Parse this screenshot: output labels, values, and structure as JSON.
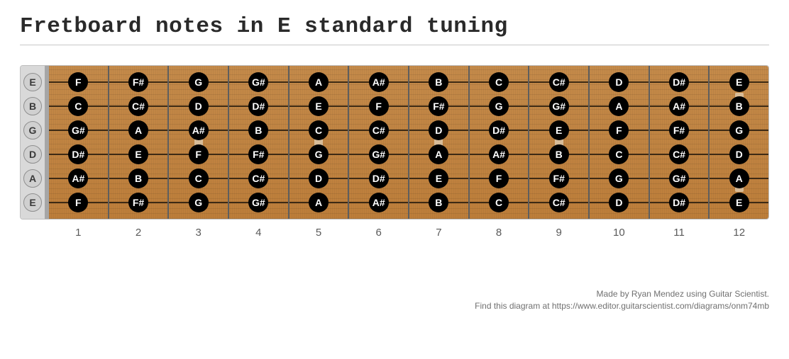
{
  "title": "Fretboard notes in E standard tuning",
  "open_strings": [
    "E",
    "B",
    "G",
    "D",
    "A",
    "E"
  ],
  "fret_numbers": [
    "1",
    "2",
    "3",
    "4",
    "5",
    "6",
    "7",
    "8",
    "9",
    "10",
    "11",
    "12"
  ],
  "inlay_frets": [
    3,
    5,
    7,
    9,
    12
  ],
  "inlay_double_fret": 12,
  "notes": [
    [
      "F",
      "F#",
      "G",
      "G#",
      "A",
      "A#",
      "B",
      "C",
      "C#",
      "D",
      "D#",
      "E"
    ],
    [
      "C",
      "C#",
      "D",
      "D#",
      "E",
      "F",
      "F#",
      "G",
      "G#",
      "A",
      "A#",
      "B"
    ],
    [
      "G#",
      "A",
      "A#",
      "B",
      "C",
      "C#",
      "D",
      "D#",
      "E",
      "F",
      "F#",
      "G"
    ],
    [
      "D#",
      "E",
      "F",
      "F#",
      "G",
      "G#",
      "A",
      "A#",
      "B",
      "C",
      "C#",
      "D"
    ],
    [
      "A#",
      "B",
      "C",
      "C#",
      "D",
      "D#",
      "E",
      "F",
      "F#",
      "G",
      "G#",
      "A"
    ],
    [
      "F",
      "F#",
      "G",
      "G#",
      "A",
      "A#",
      "B",
      "C",
      "C#",
      "D",
      "D#",
      "E"
    ]
  ],
  "credits": {
    "line1": "Made by Ryan Mendez using Guitar Scientist.",
    "line2": "Find this diagram at https://www.editor.guitarscientist.com/diagrams/onm74mb"
  },
  "colors": {
    "note_bg": "#000000",
    "note_fg": "#ffffff",
    "open_bg": "#d0d0d0",
    "wood": "#bd7e3a"
  }
}
